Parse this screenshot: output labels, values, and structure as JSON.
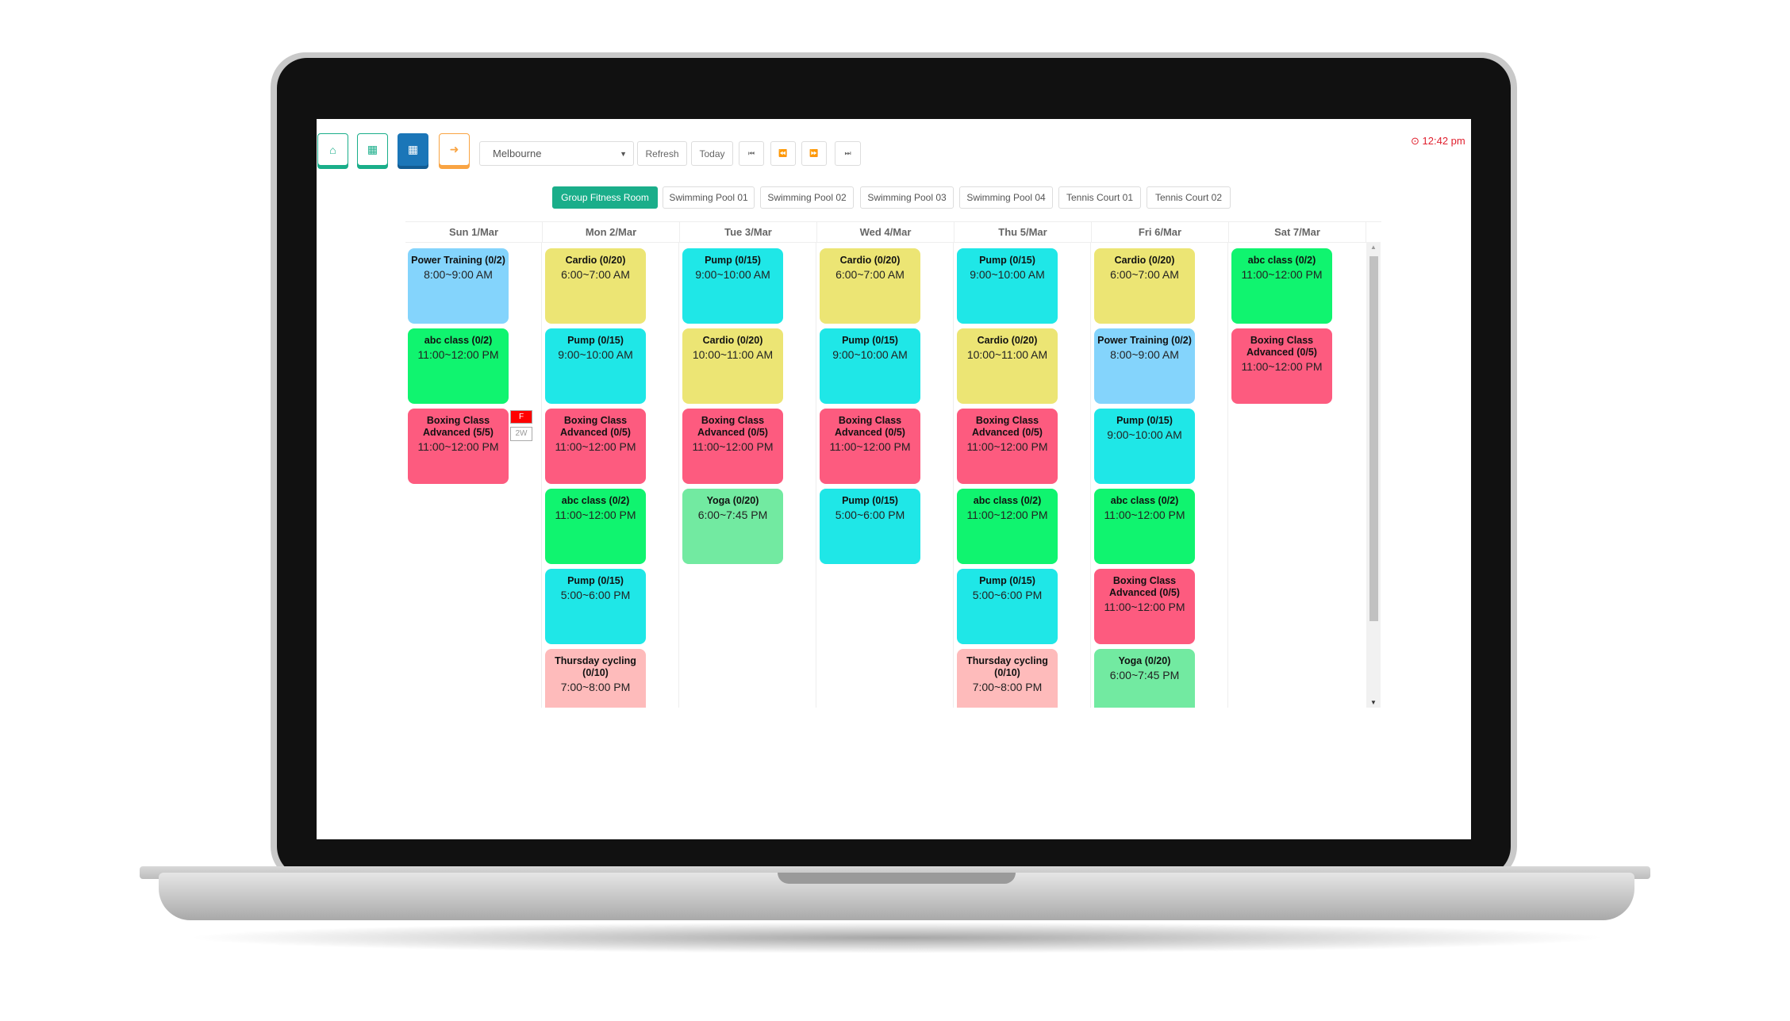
{
  "toolbar": {
    "icons": [
      "home-icon",
      "calendar-icon",
      "calendar-week-icon",
      "sign-out-icon"
    ],
    "location": "Melbourne",
    "refresh": "Refresh",
    "today": "Today",
    "first": "⏮",
    "prev": "⏪",
    "next": "⏩",
    "last": "⏭",
    "time": "12:42 pm"
  },
  "colors": {
    "accent": "#1aae8a",
    "blue": "#1b76b8",
    "orange": "#f9a443",
    "time": "#e0202e"
  },
  "rooms": [
    "Group Fitness Room",
    "Swimming Pool 01",
    "Swimming Pool 02",
    "Swimming Pool 03",
    "Swimming Pool 04",
    "Tennis Court 01",
    "Tennis Court 02"
  ],
  "days": [
    {
      "label": "Sun 1/Mar",
      "events": [
        {
          "title": "Power Training (0/2)",
          "time": "8:00~9:00 AM",
          "color": "#84d4fc"
        },
        {
          "title": "abc class (0/2)",
          "time": "11:00~12:00 PM",
          "color": "#10f46f"
        },
        {
          "title": "Boxing Class Advanced (5/5)",
          "time": "11:00~12:00 PM",
          "color": "#fd5b7f"
        }
      ]
    },
    {
      "label": "Mon 2/Mar",
      "events": [
        {
          "title": "Cardio (0/20)",
          "time": "6:00~7:00 AM",
          "color": "#ece574"
        },
        {
          "title": "Pump (0/15)",
          "time": "9:00~10:00 AM",
          "color": "#1fe7e7"
        },
        {
          "title": "Boxing Class Advanced (0/5)",
          "time": "11:00~12:00 PM",
          "color": "#fd5b7f"
        },
        {
          "title": "abc class (0/2)",
          "time": "11:00~12:00 PM",
          "color": "#10f46f"
        },
        {
          "title": "Pump (0/15)",
          "time": "5:00~6:00 PM",
          "color": "#1fe7e7"
        },
        {
          "title": "Thursday cycling (0/10)",
          "time": "7:00~8:00 PM",
          "color": "#febbbb"
        }
      ]
    },
    {
      "label": "Tue 3/Mar",
      "events": [
        {
          "title": "Pump (0/15)",
          "time": "9:00~10:00 AM",
          "color": "#1fe7e7"
        },
        {
          "title": "Cardio (0/20)",
          "time": "10:00~11:00 AM",
          "color": "#ece574"
        },
        {
          "title": "Boxing Class Advanced (0/5)",
          "time": "11:00~12:00 PM",
          "color": "#fd5b7f"
        },
        {
          "title": "Yoga (0/20)",
          "time": "6:00~7:45 PM",
          "color": "#72eaa1"
        }
      ]
    },
    {
      "label": "Wed 4/Mar",
      "events": [
        {
          "title": "Cardio (0/20)",
          "time": "6:00~7:00 AM",
          "color": "#ece574"
        },
        {
          "title": "Pump (0/15)",
          "time": "9:00~10:00 AM",
          "color": "#1fe7e7"
        },
        {
          "title": "Boxing Class Advanced (0/5)",
          "time": "11:00~12:00 PM",
          "color": "#fd5b7f"
        },
        {
          "title": "Pump (0/15)",
          "time": "5:00~6:00 PM",
          "color": "#1fe7e7"
        }
      ]
    },
    {
      "label": "Thu 5/Mar",
      "events": [
        {
          "title": "Pump (0/15)",
          "time": "9:00~10:00 AM",
          "color": "#1fe7e7"
        },
        {
          "title": "Cardio (0/20)",
          "time": "10:00~11:00 AM",
          "color": "#ece574"
        },
        {
          "title": "Boxing Class Advanced (0/5)",
          "time": "11:00~12:00 PM",
          "color": "#fd5b7f"
        },
        {
          "title": "abc class (0/2)",
          "time": "11:00~12:00 PM",
          "color": "#10f46f"
        },
        {
          "title": "Pump (0/15)",
          "time": "5:00~6:00 PM",
          "color": "#1fe7e7"
        },
        {
          "title": "Thursday cycling (0/10)",
          "time": "7:00~8:00 PM",
          "color": "#febbbb"
        }
      ]
    },
    {
      "label": "Fri 6/Mar",
      "events": [
        {
          "title": "Cardio (0/20)",
          "time": "6:00~7:00 AM",
          "color": "#ece574"
        },
        {
          "title": "Power Training (0/2)",
          "time": "8:00~9:00 AM",
          "color": "#84d4fc"
        },
        {
          "title": "Pump (0/15)",
          "time": "9:00~10:00 AM",
          "color": "#1fe7e7"
        },
        {
          "title": "abc class (0/2)",
          "time": "11:00~12:00 PM",
          "color": "#10f46f"
        },
        {
          "title": "Boxing Class Advanced (0/5)",
          "time": "11:00~12:00 PM",
          "color": "#fd5b7f"
        },
        {
          "title": "Yoga (0/20)",
          "time": "6:00~7:45 PM",
          "color": "#72eaa1"
        }
      ]
    },
    {
      "label": "Sat 7/Mar",
      "events": [
        {
          "title": "abc class (0/2)",
          "time": "11:00~12:00 PM",
          "color": "#10f46f"
        },
        {
          "title": "Boxing Class Advanced (0/5)",
          "time": "11:00~12:00 PM",
          "color": "#fd5b7f"
        }
      ]
    }
  ],
  "badges": {
    "full": "F",
    "weeks": "2W"
  }
}
